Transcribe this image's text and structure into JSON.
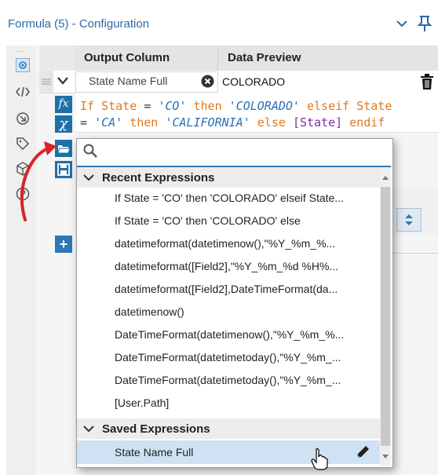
{
  "window": {
    "title": "Formula (5) - Configuration"
  },
  "grid": {
    "headers": {
      "output_column": "Output Column",
      "data_preview": "Data Preview"
    },
    "row": {
      "column_name": "State Name Full",
      "preview_value": "COLORADO"
    },
    "expression_lines": [
      [
        {
          "t": "If ",
          "c": "kw"
        },
        {
          "t": "State",
          "c": "kw"
        },
        {
          "t": " = ",
          "c": "blk"
        },
        {
          "t": "'CO'",
          "c": "str"
        },
        {
          "t": " then ",
          "c": "kw"
        },
        {
          "t": "'COLORADO'",
          "c": "str"
        },
        {
          "t": " elseif ",
          "c": "kw"
        },
        {
          "t": "State",
          "c": "kw"
        }
      ],
      [
        {
          "t": "= ",
          "c": "blk"
        },
        {
          "t": "'CA'",
          "c": "str"
        },
        {
          "t": " then ",
          "c": "kw"
        },
        {
          "t": "'CALIFORNIA'",
          "c": "str"
        },
        {
          "t": " else ",
          "c": "kw"
        },
        {
          "t": "[State]",
          "c": "br"
        },
        {
          "t": " endif",
          "c": "kw"
        }
      ]
    ]
  },
  "popup": {
    "search": {
      "value": "",
      "placeholder": ""
    },
    "recent_label": "Recent Expressions",
    "recent_items": [
      "If State = 'CO' then 'COLORADO' elseif State...",
      "If State = 'CO' then 'COLORADO' else",
      "datetimeformat(datetimenow(),\"%Y_%m_%...",
      "datetimeformat([Field2],\"%Y_%m_%d %H%...",
      "datetimeformat([Field2],DateTimeFormat(da...",
      "datetimenow()",
      "DateTimeFormat(datetimenow(),\"%Y_%m_%...",
      "DateTimeFormat(datetimetoday(),\"%Y_%m_...",
      "DateTimeFormat(datetimetoday(),\"%Y_%m_...",
      "[User.Path]"
    ],
    "saved_label": "Saved Expressions",
    "saved_items": [
      "State Name Full"
    ]
  },
  "colors": {
    "accent": "#2e78b5",
    "selection": "#cfe2f4",
    "annotation_arrow": "#d8232a"
  },
  "icons": [
    "chevron-down-icon",
    "pin-icon",
    "gear-icon",
    "code-icon",
    "rollback-icon",
    "tag-icon",
    "cube-icon",
    "help-icon",
    "fx-icon",
    "variable-icon",
    "folder-open-icon",
    "save-icon",
    "add-icon",
    "trash-icon",
    "clear-icon",
    "search-icon",
    "pencil-icon",
    "hand-cursor-icon"
  ]
}
